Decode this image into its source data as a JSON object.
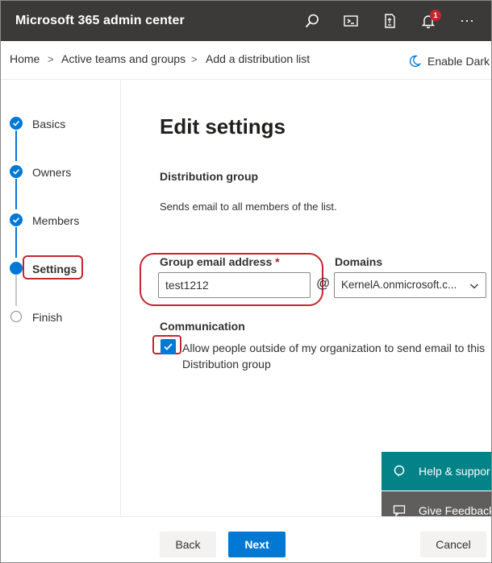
{
  "header": {
    "title": "Microsoft 365 admin center",
    "icons": [
      "search-icon",
      "terminal-icon",
      "mobile-icon",
      "bell-icon",
      "more-icon"
    ],
    "notification_count": "1",
    "more_label": "···"
  },
  "breadcrumb": {
    "items": [
      "Home",
      "Active teams and groups",
      "Add a distribution list"
    ],
    "separator": ">",
    "dark_mode_label": "Enable Dark m"
  },
  "stepper": {
    "steps": [
      {
        "label": "Basics",
        "state": "done"
      },
      {
        "label": "Owners",
        "state": "done"
      },
      {
        "label": "Members",
        "state": "done"
      },
      {
        "label": "Settings",
        "state": "current"
      },
      {
        "label": "Finish",
        "state": "pending"
      }
    ]
  },
  "main": {
    "title": "Edit settings",
    "section_heading": "Distribution group",
    "section_description": "Sends email to all members of the list.",
    "email_label": "Group email address",
    "required_mark": "*",
    "email_value": "test1212",
    "at_sign": "@",
    "domains_label": "Domains",
    "domain_value": "KernelA.onmicrosoft.c...",
    "communication_label": "Communication",
    "checkbox_checked": true,
    "checkbox_text": "Allow people outside of my organization to send email to this Distribution group"
  },
  "panels": {
    "help_label": "Help & suppor",
    "feedback_label": "Give Feedback"
  },
  "footer": {
    "back_label": "Back",
    "next_label": "Next",
    "cancel_label": "Cancel"
  },
  "colors": {
    "topbar": "#3b3a39",
    "accent": "#0078d4",
    "highlight": "#c4262e",
    "help": "#038387",
    "feedback": "#605e5c"
  }
}
